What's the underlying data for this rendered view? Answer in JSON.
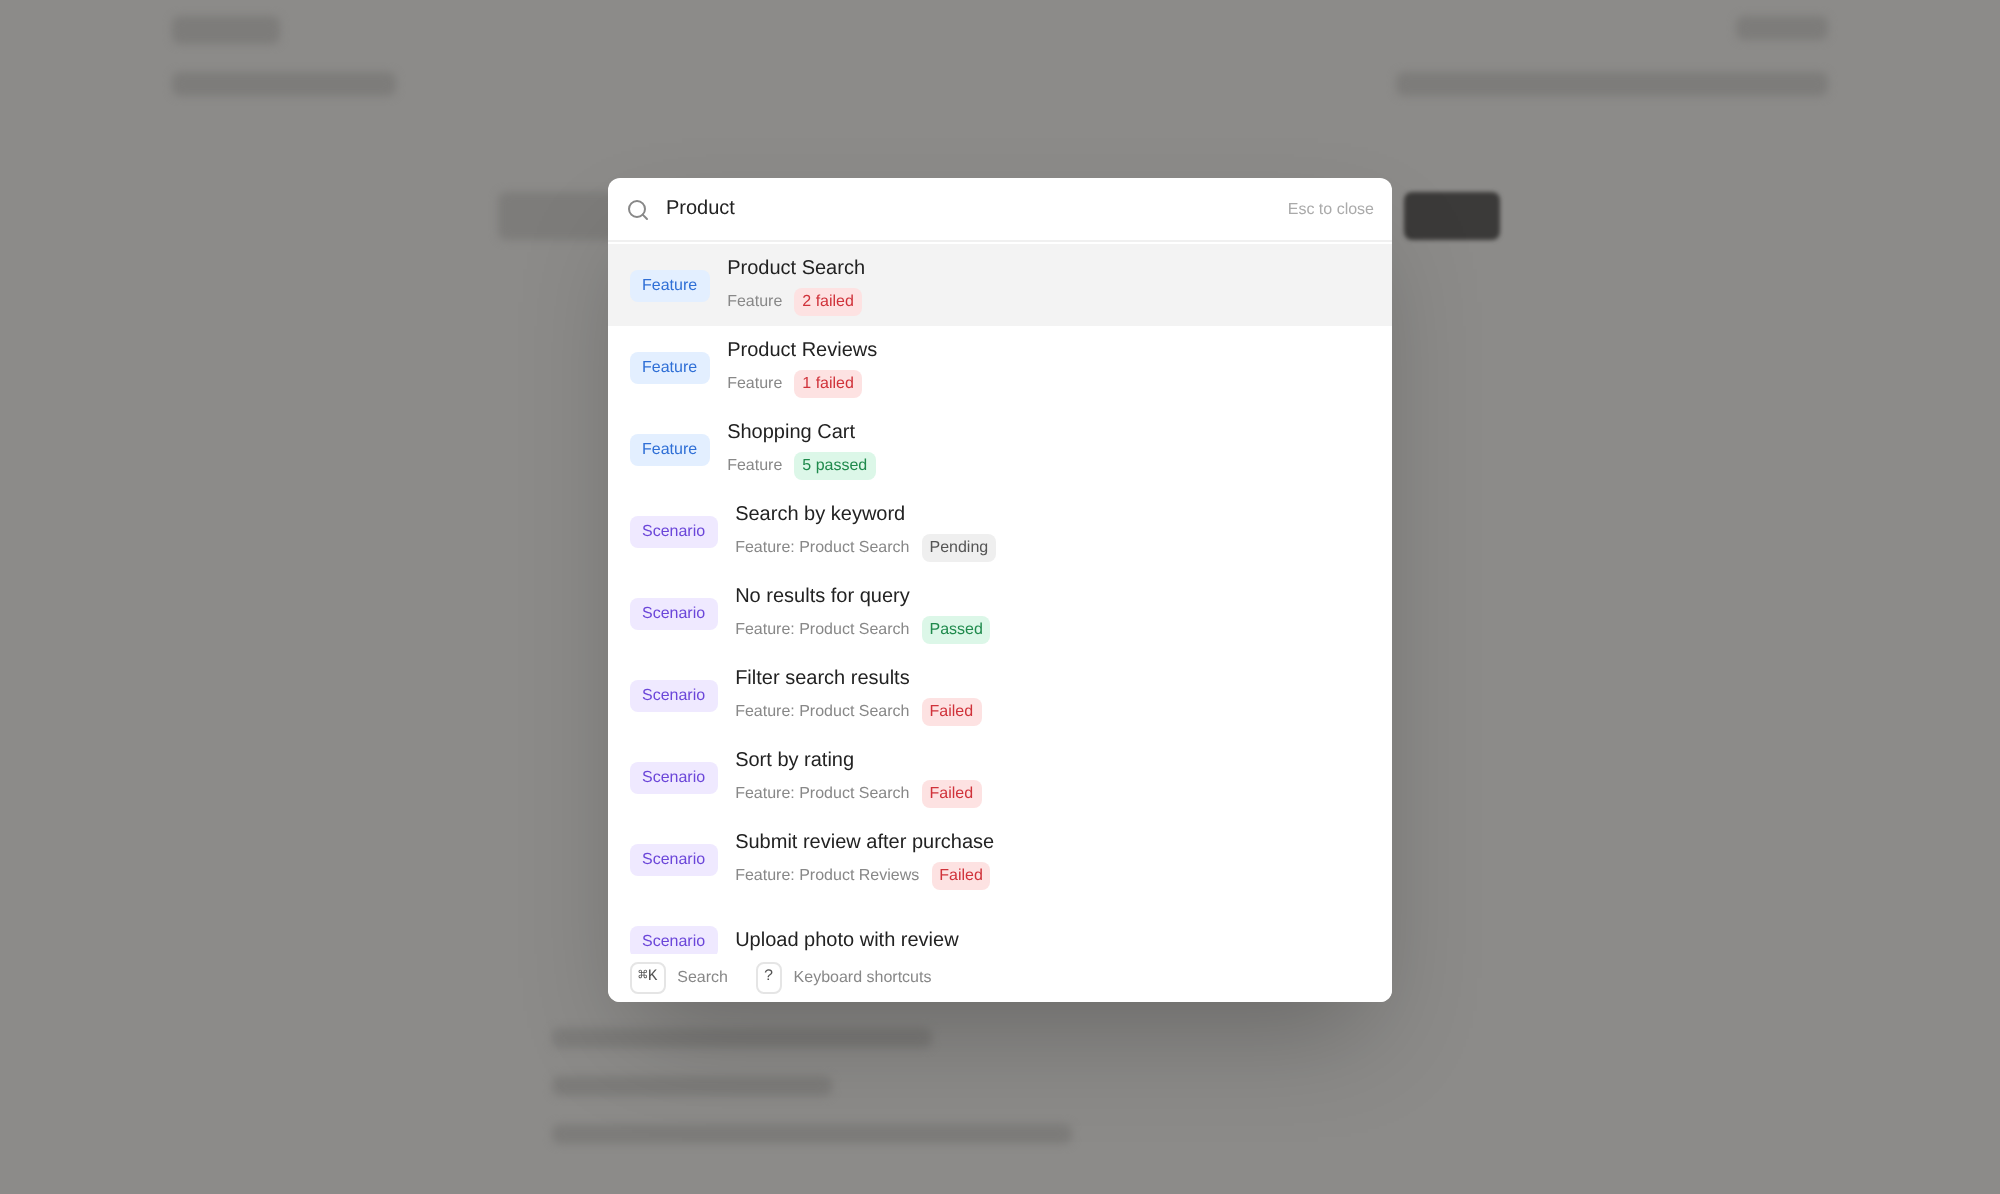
{
  "search": {
    "value": "Product",
    "hint": "Esc to close"
  },
  "results": [
    {
      "kind": "feature",
      "tag": "Feature",
      "title": "Product Search",
      "subtitle": "Feature",
      "status": {
        "label": "2 failed",
        "kind": "failed"
      },
      "selected": true
    },
    {
      "kind": "feature",
      "tag": "Feature",
      "title": "Product Reviews",
      "subtitle": "Feature",
      "status": {
        "label": "1 failed",
        "kind": "failed"
      },
      "selected": false
    },
    {
      "kind": "feature",
      "tag": "Feature",
      "title": "Shopping Cart",
      "subtitle": "Feature",
      "status": {
        "label": "5 passed",
        "kind": "passed"
      },
      "selected": false
    },
    {
      "kind": "scenario",
      "tag": "Scenario",
      "title": "Search by keyword",
      "subtitle": "Feature: Product Search",
      "status": {
        "label": "Pending",
        "kind": "pending"
      },
      "selected": false
    },
    {
      "kind": "scenario",
      "tag": "Scenario",
      "title": "No results for query",
      "subtitle": "Feature: Product Search",
      "status": {
        "label": "Passed",
        "kind": "passed"
      },
      "selected": false
    },
    {
      "kind": "scenario",
      "tag": "Scenario",
      "title": "Filter search results",
      "subtitle": "Feature: Product Search",
      "status": {
        "label": "Failed",
        "kind": "failed"
      },
      "selected": false
    },
    {
      "kind": "scenario",
      "tag": "Scenario",
      "title": "Sort by rating",
      "subtitle": "Feature: Product Search",
      "status": {
        "label": "Failed",
        "kind": "failed"
      },
      "selected": false
    },
    {
      "kind": "scenario",
      "tag": "Scenario",
      "title": "Submit review after purchase",
      "subtitle": "Feature: Product Reviews",
      "status": {
        "label": "Failed",
        "kind": "failed"
      },
      "selected": false
    },
    {
      "kind": "scenario",
      "tag": "Scenario",
      "title": "Upload photo with review",
      "selected": false
    }
  ],
  "footer": [
    {
      "key": "⌘K",
      "label": "Search"
    },
    {
      "key": "?",
      "label": "Keyboard shortcuts"
    }
  ]
}
